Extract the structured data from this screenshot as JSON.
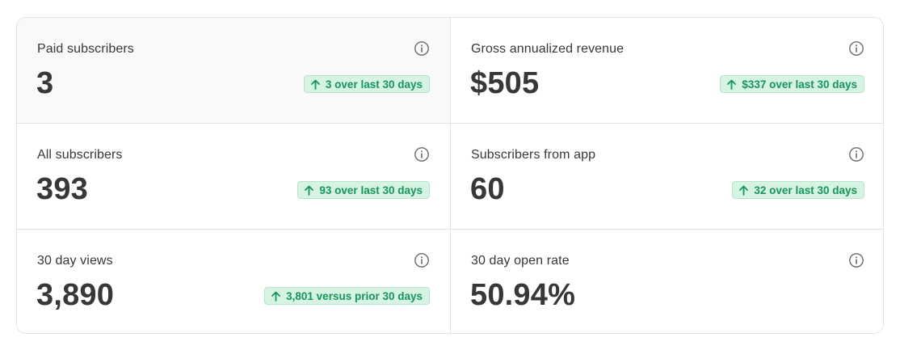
{
  "colors": {
    "badge_bg": "#d6f3e4",
    "badge_text": "#16965a",
    "text": "#363737",
    "border": "#e4e4e4"
  },
  "metrics": [
    {
      "label": "Paid subscribers",
      "value": "3",
      "change": "3 over last 30 days",
      "icon": "info-icon"
    },
    {
      "label": "Gross annualized revenue",
      "value": "$505",
      "change": "$337 over last 30 days",
      "icon": "info-icon"
    },
    {
      "label": "All subscribers",
      "value": "393",
      "change": "93 over last 30 days",
      "icon": "info-icon"
    },
    {
      "label": "Subscribers from app",
      "value": "60",
      "change": "32 over last 30 days",
      "icon": "info-icon"
    },
    {
      "label": "30 day views",
      "value": "3,890",
      "change": "3,801 versus prior 30 days",
      "icon": "info-icon"
    },
    {
      "label": "30 day open rate",
      "value": "50.94%",
      "icon": "info-icon"
    }
  ]
}
